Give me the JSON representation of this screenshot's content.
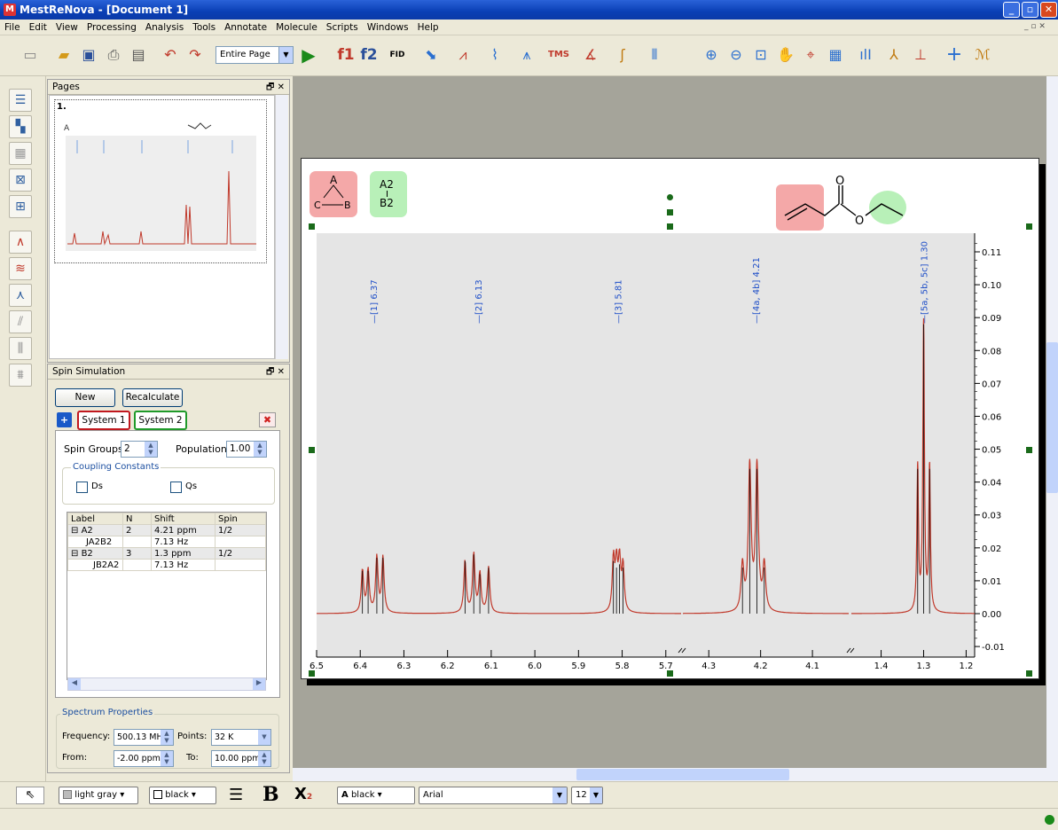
{
  "window": {
    "title": "MestReNova - [Document 1]"
  },
  "menu": [
    "File",
    "Edit",
    "View",
    "Processing",
    "Analysis",
    "Tools",
    "Annotate",
    "Molecule",
    "Scripts",
    "Windows",
    "Help"
  ],
  "toolbar": {
    "page_zoom": "Entire Page",
    "f1": "f1",
    "f2": "f2",
    "fid": "FID",
    "tms": "TMS"
  },
  "pages_panel": {
    "title": "Pages",
    "page_number": "1."
  },
  "spin_panel": {
    "title": "Spin Simulation",
    "new_label": "New",
    "recalc_label": "Recalculate",
    "tabs": [
      "System 1",
      "System 2"
    ],
    "spin_groups_label": "Spin Groups:",
    "spin_groups_value": "2",
    "population_label": "Population:",
    "population_value": "1.00",
    "coupling_label": "Coupling Constants",
    "ds_label": "Ds",
    "qs_label": "Qs",
    "table": {
      "headers": [
        "Label",
        "N",
        "Shift",
        "Spin"
      ],
      "rows": [
        {
          "label": "A2",
          "n": "2",
          "shift": "4.21 ppm",
          "spin": "1/2"
        },
        {
          "label": "JA2B2",
          "n": "",
          "shift": "7.13 Hz",
          "spin": ""
        },
        {
          "label": "B2",
          "n": "3",
          "shift": "1.3 ppm",
          "spin": "1/2"
        },
        {
          "label": "JB2A2",
          "n": "",
          "shift": "7.13 Hz",
          "spin": ""
        }
      ]
    },
    "spectrum_props_label": "Spectrum Properties",
    "frequency_label": "Frequency:",
    "frequency_value": "500.13 MHz",
    "points_label": "Points:",
    "points_value": "32 K",
    "from_label": "From:",
    "from_value": "-2.00 ppm",
    "to_label": "To:",
    "to_value": "10.00 ppm"
  },
  "document": {
    "system1_badge": {
      "top": "A",
      "left": "C",
      "right": "B"
    },
    "system2_badge": {
      "top": "A2",
      "bottom": "B2"
    }
  },
  "bottombar": {
    "fill": "light gray",
    "line": "black",
    "bold": "B",
    "sub": "X",
    "text_color": "black",
    "font": "Arial",
    "size": "12"
  },
  "chart_data": {
    "type": "line",
    "xlabel": "",
    "ylabel": "",
    "x_ticks": [
      "6.5",
      "6.4",
      "6.3",
      "6.2",
      "6.1",
      "6.0",
      "5.9",
      "5.8",
      "5.7",
      "4.3",
      "4.2",
      "4.1",
      "1.4",
      "1.3",
      "1.2"
    ],
    "y_ticks": [
      "0.11",
      "0.10",
      "0.09",
      "0.08",
      "0.07",
      "0.06",
      "0.05",
      "0.04",
      "0.03",
      "0.02",
      "0.01",
      "0.00",
      "-0.01"
    ],
    "ylim": [
      -0.01,
      0.115
    ],
    "peak_labels": [
      "[1] 6.37",
      "[2] 6.13",
      "[3] 5.81",
      "[4a, 4b] 4.21",
      "[5a, 5b, 5c] 1.30"
    ],
    "multiplets": [
      {
        "segment": 0,
        "center": 6.37,
        "lines": [
          6.395,
          6.382,
          6.362,
          6.348
        ],
        "heights": [
          0.013,
          0.013,
          0.017,
          0.017
        ]
      },
      {
        "segment": 0,
        "center": 6.13,
        "lines": [
          6.16,
          6.14,
          6.126,
          6.106
        ],
        "heights": [
          0.016,
          0.018,
          0.012,
          0.014
        ]
      },
      {
        "segment": 0,
        "center": 5.81,
        "lines": [
          5.82,
          5.813,
          5.806,
          5.798
        ],
        "heights": [
          0.016,
          0.014,
          0.015,
          0.014
        ]
      },
      {
        "segment": 1,
        "center": 4.21,
        "lines": [
          4.235,
          4.221,
          4.207,
          4.193
        ],
        "heights": [
          0.014,
          0.044,
          0.044,
          0.014
        ]
      },
      {
        "segment": 2,
        "center": 1.3,
        "lines": [
          1.314,
          1.3,
          1.286
        ],
        "heights": [
          0.044,
          0.088,
          0.044
        ]
      }
    ],
    "colors": {
      "line": "#c0392b",
      "sticks": "#000000",
      "labels": "#1f4fc8"
    }
  }
}
